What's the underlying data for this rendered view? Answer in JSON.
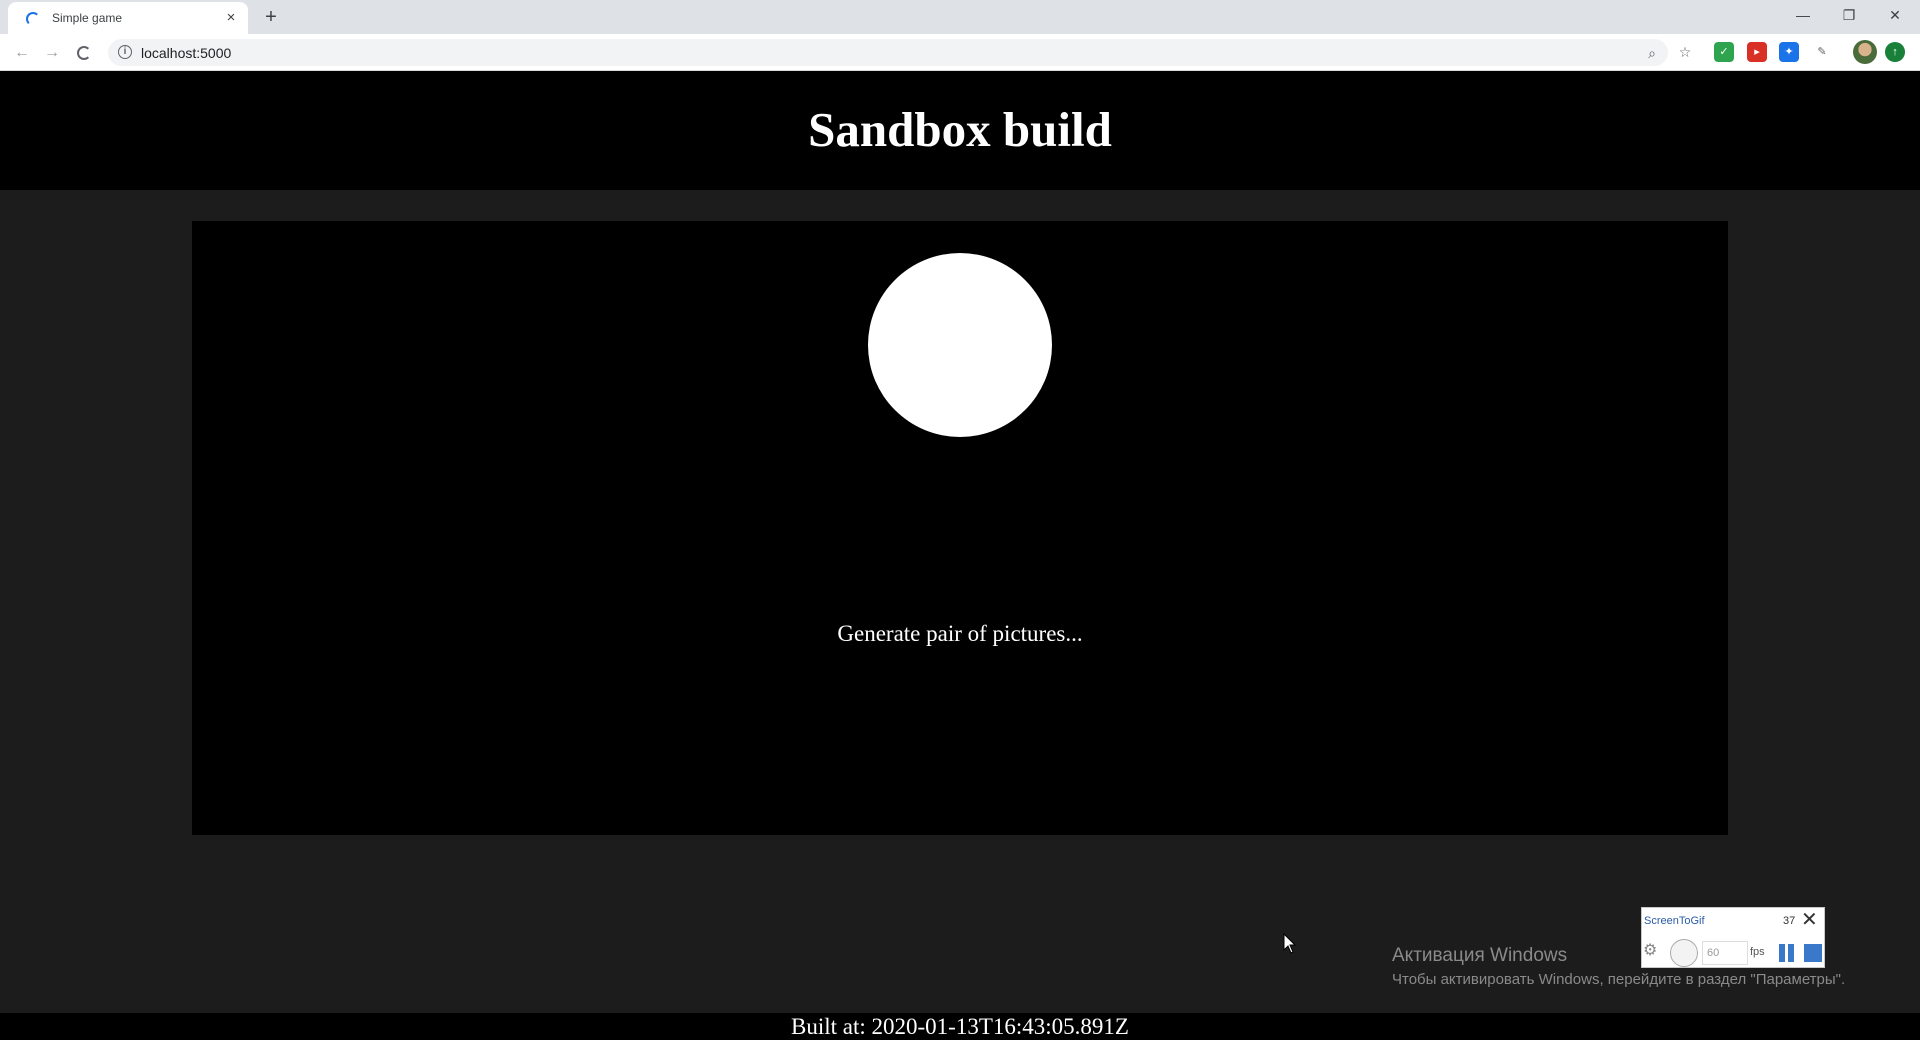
{
  "browser": {
    "tab_title": "Simple game",
    "tab_close": "×",
    "new_tab": "+",
    "url": "localhost:5000",
    "window_controls": {
      "minimize": "—",
      "restore": "❐",
      "close": "✕"
    },
    "extensions": [
      {
        "name": "shield-extension-icon",
        "color": "#2ea44f"
      },
      {
        "name": "red-extension-icon",
        "color": "#d93025"
      },
      {
        "name": "blue-extension-icon",
        "color": "#1a73e8"
      },
      {
        "name": "eyedropper-extension-icon",
        "color": "#5f6368"
      },
      {
        "name": "green-extension-icon",
        "color": "#188038"
      }
    ]
  },
  "page": {
    "title": "Sandbox build",
    "status": "Generate pair of pictures...",
    "build_info": "Built at: 2020-01-13T16:43:05.891Z"
  },
  "activation": {
    "title": "Активация Windows",
    "text": "Чтобы активировать Windows, перейдите в раздел \"Параметры\"."
  },
  "screentogif": {
    "title": "ScreenToGif",
    "frame_count": "37",
    "fps_value": "60",
    "fps_label": "fps"
  },
  "colors": {
    "accent": "#1a73e8",
    "page_background": "#1c1c1c",
    "header_background": "#000000"
  }
}
